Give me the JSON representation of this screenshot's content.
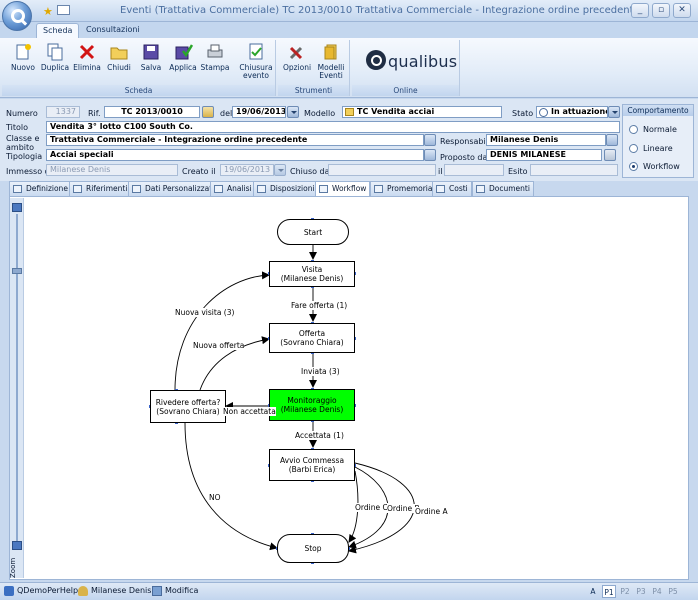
{
  "window": {
    "title": "Eventi (Trattativa Commerciale)  TC 2013/0010 Trattativa Commerciale - Integrazione ordine precedente",
    "controls": [
      "minimize",
      "restore",
      "close"
    ]
  },
  "ribbon": {
    "tabs": [
      "Scheda",
      "Consultazioni"
    ],
    "active_tab": "Scheda",
    "groups": [
      {
        "label": "Scheda",
        "buttons": [
          "Nuovo",
          "Duplica",
          "Elimina",
          "Chiudi",
          "Salva",
          "Applica",
          "Stampa",
          "Chiusura",
          "evento"
        ]
      },
      {
        "label": "Strumenti",
        "buttons": [
          "Opzioni",
          "Modelli",
          "Eventi"
        ]
      },
      {
        "label": "Online",
        "buttons": []
      }
    ],
    "brand": "qualibus"
  },
  "form": {
    "numero_label": "Numero",
    "numero_value": "1337",
    "rif_label": "Rif.",
    "rif_value": "TC 2013/0010",
    "del_label": "del",
    "del_value": "19/06/2013",
    "modello_label": "Modello",
    "modello_value": "TC Vendita acciai",
    "stato_label": "Stato",
    "stato_value": "In attuazione",
    "titolo_label": "Titolo",
    "titolo_value": "Vendita 3° lotto C100 South Co.",
    "classe_label": "Classe e",
    "classe_label2": "ambito",
    "classe_value": "Trattativa Commerciale - Integrazione ordine precedente",
    "responsabile_label": "Responsabile",
    "responsabile_value": "Milanese Denis",
    "tipologia_label": "Tipologia",
    "tipologia_value": "Acciai speciali",
    "proposto_label": "Proposto da",
    "proposto_value": "DENIS MILANESE",
    "immesso_label": "Immesso da",
    "immesso_value": "Milanese Denis",
    "creato_label": "Creato il",
    "creato_value": "19/06/2013",
    "chiuso_label": "Chiuso da",
    "chiuso_value": "",
    "i_label": "il",
    "esito_label": "Esito",
    "esito_value": ""
  },
  "comportamento": {
    "title": "Comportamento",
    "options": [
      "Normale",
      "Lineare",
      "Workflow"
    ],
    "selected": "Workflow"
  },
  "tabs": [
    "Definizione",
    "Riferimenti",
    "Dati Personalizzati",
    "Analisi",
    "Disposizioni",
    "Workflow",
    "Promemoria",
    "Costi",
    "Documenti"
  ],
  "active_tab": "Workflow",
  "zoom_label": "Zoom",
  "workflow": {
    "nodes": {
      "start": "Start",
      "visita": [
        "Visita",
        "(Milanese Denis)"
      ],
      "offerta": [
        "Offerta",
        "(Sovrano Chiara)"
      ],
      "rivedere": [
        "Rivedere offerta?",
        "(Sovrano Chiara)"
      ],
      "monitoraggio": [
        "Monitoraggio",
        "(Milanese Denis)"
      ],
      "avvio": [
        "Avvio Commessa",
        "(Barbi Erica)"
      ],
      "stop": "Stop"
    },
    "edges": {
      "fare_offerta": "Fare offerta (1)",
      "inviata": "Inviata (3)",
      "accettata": "Accettata (1)",
      "non_accettata": "Non accettata",
      "nuova_visita": "Nuova visita (3)",
      "nuova_offerta": "Nuova offerta",
      "no": "NO",
      "ordine_c": "Ordine C",
      "ordine_b": "Ordine B",
      "ordine_a": "Ordine A"
    },
    "active_node_color": "#00ff00"
  },
  "statusbar": {
    "db": "QDemoPerHelp",
    "user": "Milanese Denis",
    "mode": "Modifica",
    "a": "A",
    "pages": [
      "P1",
      "P2",
      "P3",
      "P4",
      "P5"
    ],
    "active_page": "P1"
  }
}
